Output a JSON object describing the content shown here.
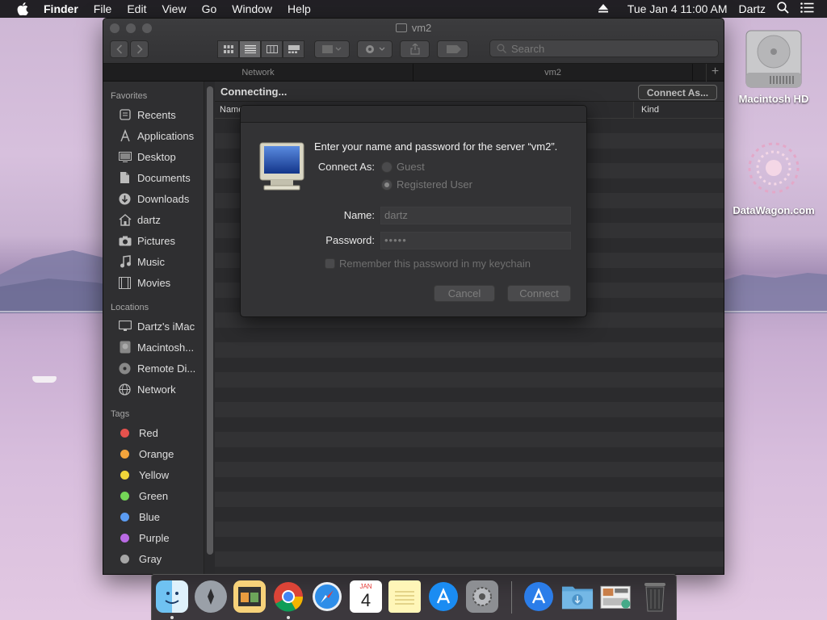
{
  "menubar": {
    "app_name": "Finder",
    "items": [
      "File",
      "Edit",
      "View",
      "Go",
      "Window",
      "Help"
    ],
    "datetime": "Tue Jan 4  11:00 AM",
    "user": "Dartz"
  },
  "window": {
    "title": "vm2",
    "search_placeholder": "Search",
    "path_tabs": [
      "Network",
      "vm2"
    ],
    "status": "Connecting...",
    "connect_as_label": "Connect As...",
    "columns": [
      "Name",
      "Kind"
    ]
  },
  "sidebar": {
    "favorites_heading": "Favorites",
    "favorites": [
      {
        "label": "Recents",
        "icon": "recents-icon"
      },
      {
        "label": "Applications",
        "icon": "applications-icon"
      },
      {
        "label": "Desktop",
        "icon": "desktop-icon"
      },
      {
        "label": "Documents",
        "icon": "documents-icon"
      },
      {
        "label": "Downloads",
        "icon": "downloads-icon"
      },
      {
        "label": "dartz",
        "icon": "home-icon"
      },
      {
        "label": "Pictures",
        "icon": "pictures-icon"
      },
      {
        "label": "Music",
        "icon": "music-icon"
      },
      {
        "label": "Movies",
        "icon": "movies-icon"
      }
    ],
    "locations_heading": "Locations",
    "locations": [
      {
        "label": "Dartz's iMac",
        "icon": "imac-icon"
      },
      {
        "label": "Macintosh...",
        "icon": "hard-drive-icon"
      },
      {
        "label": "Remote Di...",
        "icon": "disc-icon"
      },
      {
        "label": "Network",
        "icon": "network-icon"
      }
    ],
    "tags_heading": "Tags",
    "tags": [
      {
        "label": "Red",
        "color": "#ff5f57"
      },
      {
        "label": "Orange",
        "color": "#f7a23b"
      },
      {
        "label": "Yellow",
        "color": "#f5d93a"
      },
      {
        "label": "Green",
        "color": "#6ad84f"
      },
      {
        "label": "Blue",
        "color": "#4b9cf5"
      },
      {
        "label": "Purple",
        "color": "#bb6ae8"
      },
      {
        "label": "Gray",
        "color": "#a6a6a6"
      }
    ]
  },
  "dialog": {
    "message": "Enter your name and password for the server “vm2”.",
    "connect_as_label": "Connect As:",
    "guest_label": "Guest",
    "registered_label": "Registered User",
    "name_label": "Name:",
    "name_value": "dartz",
    "password_label": "Password:",
    "password_value": "•••••",
    "remember_label": "Remember this password in my keychain",
    "cancel_label": "Cancel",
    "connect_label": "Connect"
  },
  "desktop": {
    "hd_label": "Macintosh HD",
    "datawagon_label": "DataWagon.com"
  },
  "dock": {
    "apps": [
      "finder-icon",
      "launchpad-icon",
      "photo-slideshow-icon",
      "chrome-icon",
      "safari-icon",
      "calendar-icon",
      "notes-icon",
      "app-store-icon",
      "system-preferences-icon",
      "app-store-downloads-icon",
      "downloads-folder-icon",
      "preview-stack-icon",
      "trash-icon"
    ],
    "calendar_month": "JAN",
    "calendar_day": "4"
  }
}
